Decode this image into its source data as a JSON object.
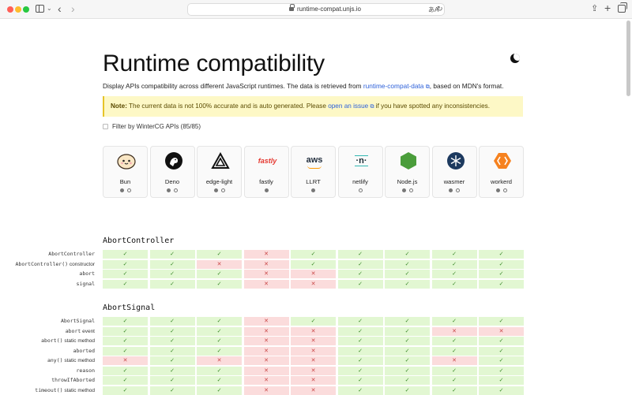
{
  "browser": {
    "url": "runtime-compat.unjs.io",
    "translate_label": "あA",
    "reload_label": "↻"
  },
  "page": {
    "title": "Runtime compatibility",
    "description_prefix": "Display APIs compatibility across different JavaScript runtimes. The data is retrieved from ",
    "description_link": "runtime-compat-data",
    "description_suffix": ", based on MDN's format.",
    "note_label": "Note:",
    "note_text": " The current data is not 100% accurate and is auto generated. Please ",
    "note_link": "open an issue",
    "note_suffix": " if you have spotted any inconsistencies.",
    "filter_label": "Filter by WinterCG APIs (85/85)"
  },
  "runtimes": [
    {
      "name": "Bun",
      "icon": "bun-logo-icon"
    },
    {
      "name": "Deno",
      "icon": "deno-logo-icon"
    },
    {
      "name": "edge-light",
      "icon": "edge-light-logo-icon"
    },
    {
      "name": "fastly",
      "icon": "fastly-logo-icon"
    },
    {
      "name": "LLRT",
      "icon": "aws-logo-icon"
    },
    {
      "name": "netlify",
      "icon": "netlify-logo-icon"
    },
    {
      "name": "Node.js",
      "icon": "nodejs-logo-icon"
    },
    {
      "name": "wasmer",
      "icon": "wasmer-logo-icon"
    },
    {
      "name": "workerd",
      "icon": "workerd-logo-icon"
    }
  ],
  "logo_text": {
    "fastly": "fastly",
    "aws": "aws",
    "netlify": "·n·"
  },
  "symbols": {
    "yes": "✓",
    "no": "✕"
  },
  "colors": {
    "yes_bg": "#e2f7d2",
    "no_bg": "#fbdcdc",
    "note_bg": "#fdf8c6",
    "link": "#2b5fd9"
  },
  "sections": [
    {
      "title": "AbortController",
      "rows": [
        {
          "label": "AbortController",
          "suffix": "",
          "values": [
            1,
            1,
            1,
            0,
            1,
            1,
            1,
            1,
            1
          ]
        },
        {
          "label": "AbortController()",
          "suffix": " constructor",
          "values": [
            1,
            1,
            0,
            0,
            1,
            1,
            1,
            1,
            1
          ]
        },
        {
          "label": "abort",
          "suffix": "",
          "values": [
            1,
            1,
            1,
            0,
            0,
            1,
            1,
            1,
            1
          ]
        },
        {
          "label": "signal",
          "suffix": "",
          "values": [
            1,
            1,
            1,
            0,
            0,
            1,
            1,
            1,
            1
          ]
        }
      ]
    },
    {
      "title": "AbortSignal",
      "rows": [
        {
          "label": "AbortSignal",
          "suffix": "",
          "values": [
            1,
            1,
            1,
            0,
            1,
            1,
            1,
            1,
            1
          ]
        },
        {
          "label": "abort",
          "suffix": " event",
          "values": [
            1,
            1,
            1,
            0,
            0,
            1,
            1,
            0,
            0
          ]
        },
        {
          "label": "abort()",
          "suffix": " static method",
          "values": [
            1,
            1,
            1,
            0,
            0,
            1,
            1,
            1,
            1
          ]
        },
        {
          "label": "aborted",
          "suffix": "",
          "values": [
            1,
            1,
            1,
            0,
            0,
            1,
            1,
            1,
            1
          ]
        },
        {
          "label": "any()",
          "suffix": " static method",
          "values": [
            0,
            1,
            0,
            0,
            0,
            1,
            1,
            0,
            1
          ]
        },
        {
          "label": "reason",
          "suffix": "",
          "values": [
            1,
            1,
            1,
            0,
            0,
            1,
            1,
            1,
            1
          ]
        },
        {
          "label": "throwIfAborted",
          "suffix": "",
          "values": [
            1,
            1,
            1,
            0,
            0,
            1,
            1,
            1,
            1
          ]
        },
        {
          "label": "timeout()",
          "suffix": " static method",
          "values": [
            1,
            1,
            1,
            0,
            0,
            1,
            1,
            1,
            1
          ]
        }
      ]
    }
  ]
}
